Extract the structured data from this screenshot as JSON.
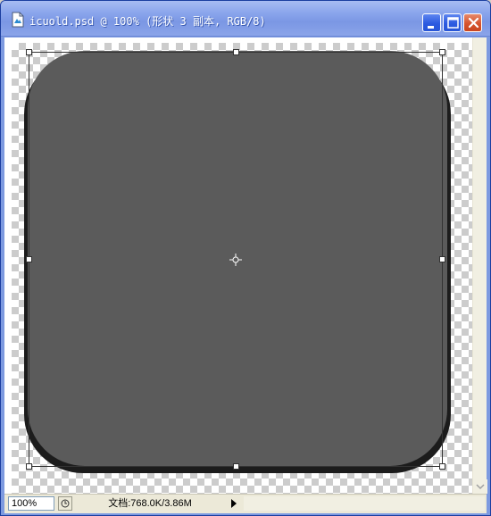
{
  "window": {
    "title": "icuold.psd @ 100% (形状 3 副本, RGB/8)",
    "buttons": {
      "minimize": "minimize-icon",
      "maximize": "maximize-icon",
      "close": "close-icon"
    }
  },
  "canvas": {
    "shape_color": "#5b5b5b",
    "layer": "形状 3 副本"
  },
  "statusbar": {
    "zoom": "100%",
    "doc_info": "文档:768.0K/3.86M"
  },
  "colors": {
    "titlebar": "#8aa5ec",
    "close_button": "#d5542e",
    "shape": "#5b5b5b"
  }
}
